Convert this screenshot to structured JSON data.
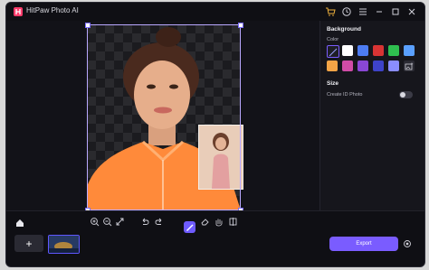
{
  "window": {
    "title": "HitPaw Photo AI"
  },
  "titlebar": {
    "icons": [
      "cart-icon",
      "history-icon",
      "menu-icon",
      "minimize-icon",
      "maximize-icon",
      "close-icon"
    ]
  },
  "panel": {
    "background_title": "Background",
    "color_label": "Color",
    "size_title": "Size",
    "create_id_label": "Create ID Photo",
    "create_id_enabled": false,
    "colors": [
      {
        "name": "none",
        "hex": "#1e1e26"
      },
      {
        "name": "white",
        "hex": "#ffffff"
      },
      {
        "name": "blue",
        "hex": "#4d7cf2"
      },
      {
        "name": "red",
        "hex": "#d93434"
      },
      {
        "name": "green",
        "hex": "#2fbf4f"
      },
      {
        "name": "sky-blue",
        "hex": "#5aa0ff"
      },
      {
        "name": "orange",
        "hex": "#f4a446"
      },
      {
        "name": "pink",
        "hex": "#d14ca7"
      },
      {
        "name": "purple",
        "hex": "#8a47d6"
      },
      {
        "name": "indigo",
        "hex": "#3e43c9"
      },
      {
        "name": "lavender",
        "hex": "#8a8dff"
      }
    ]
  },
  "toolbar": {
    "tools": [
      "zoom-in-icon",
      "zoom-out-icon",
      "fit-icon",
      "undo-icon",
      "redo-icon",
      "brush-icon",
      "eraser-icon",
      "hand-icon",
      "compare-icon"
    ],
    "add_label": "+",
    "export_label": "Export"
  },
  "colors": {
    "accent": "#7a5cff",
    "bg": "#121218"
  }
}
